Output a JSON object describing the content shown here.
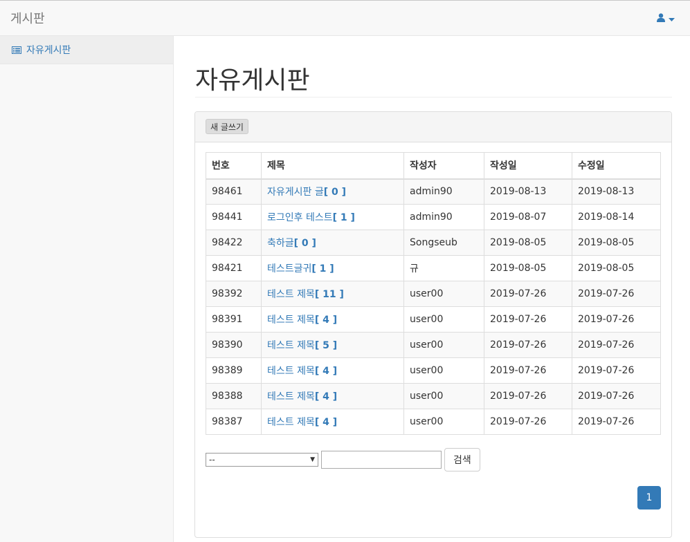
{
  "navbar": {
    "brand": "게시판",
    "user_icon": "user-icon",
    "caret_icon": "caret-down-icon",
    "accent": "#337ab7"
  },
  "sidebar": {
    "items": [
      {
        "label": "자유게시판",
        "icon": "list-icon"
      }
    ]
  },
  "main": {
    "title": "자유게시판",
    "new_post_label": "새 글쓰기",
    "columns": [
      "번호",
      "제목",
      "작성자",
      "작성일",
      "수정일"
    ],
    "rows": [
      {
        "no": "98461",
        "title": "자유게시판 글",
        "count": "[ 0 ]",
        "author": "admin90",
        "created": "2019-08-13",
        "modified": "2019-08-13"
      },
      {
        "no": "98441",
        "title": "로그인후 테스트",
        "count": "[ 1 ]",
        "author": "admin90",
        "created": "2019-08-07",
        "modified": "2019-08-14"
      },
      {
        "no": "98422",
        "title": "축하글",
        "count": "[ 0 ]",
        "author": "Songseub",
        "created": "2019-08-05",
        "modified": "2019-08-05"
      },
      {
        "no": "98421",
        "title": "테스트글귀",
        "count": "[ 1 ]",
        "author": "규",
        "created": "2019-08-05",
        "modified": "2019-08-05"
      },
      {
        "no": "98392",
        "title": "테스트 제목",
        "count": "[ 11 ]",
        "author": "user00",
        "created": "2019-07-26",
        "modified": "2019-07-26"
      },
      {
        "no": "98391",
        "title": "테스트 제목",
        "count": "[ 4 ]",
        "author": "user00",
        "created": "2019-07-26",
        "modified": "2019-07-26"
      },
      {
        "no": "98390",
        "title": "테스트 제목",
        "count": "[ 5 ]",
        "author": "user00",
        "created": "2019-07-26",
        "modified": "2019-07-26"
      },
      {
        "no": "98389",
        "title": "테스트 제목",
        "count": "[ 4 ]",
        "author": "user00",
        "created": "2019-07-26",
        "modified": "2019-07-26"
      },
      {
        "no": "98388",
        "title": "테스트 제목",
        "count": "[ 4 ]",
        "author": "user00",
        "created": "2019-07-26",
        "modified": "2019-07-26"
      },
      {
        "no": "98387",
        "title": "테스트 제목",
        "count": "[ 4 ]",
        "author": "user00",
        "created": "2019-07-26",
        "modified": "2019-07-26"
      }
    ],
    "search": {
      "type_selected": "--",
      "input_value": "",
      "button_label": "검색"
    },
    "pagination": {
      "current_page": "1"
    }
  }
}
